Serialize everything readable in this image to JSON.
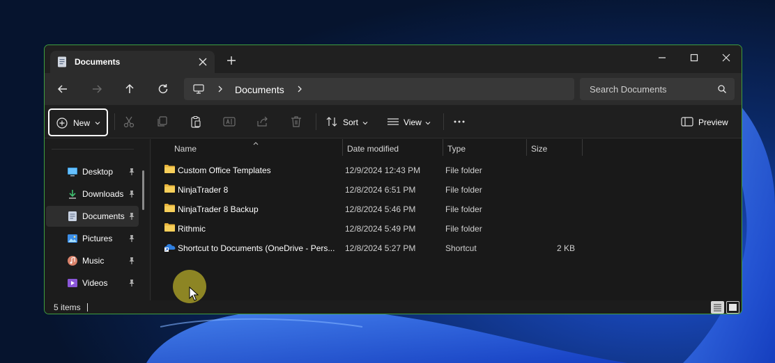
{
  "window": {
    "tab_title": "Documents",
    "accent_border": "#3f9f3f"
  },
  "navigation": {
    "breadcrumb": "Documents",
    "search_placeholder": "Search Documents"
  },
  "toolbar": {
    "new_label": "New",
    "sort_label": "Sort",
    "view_label": "View",
    "preview_label": "Preview"
  },
  "sidebar": {
    "items": [
      {
        "label": "Desktop",
        "icon": "desktop-icon",
        "pinned": true
      },
      {
        "label": "Downloads",
        "icon": "download-icon",
        "pinned": true
      },
      {
        "label": "Documents",
        "icon": "document-icon",
        "pinned": true,
        "selected": true
      },
      {
        "label": "Pictures",
        "icon": "pictures-icon",
        "pinned": true
      },
      {
        "label": "Music",
        "icon": "music-icon",
        "pinned": true
      },
      {
        "label": "Videos",
        "icon": "videos-icon",
        "pinned": true
      }
    ]
  },
  "filelist": {
    "columns": [
      "Name",
      "Date modified",
      "Type",
      "Size"
    ],
    "rows": [
      {
        "name": "Custom Office Templates",
        "date": "12/9/2024 12:43 PM",
        "type": "File folder",
        "size": "",
        "icon": "folder-icon"
      },
      {
        "name": "NinjaTrader 8",
        "date": "12/8/2024 6:51 PM",
        "type": "File folder",
        "size": "",
        "icon": "folder-icon"
      },
      {
        "name": "NinjaTrader 8 Backup",
        "date": "12/8/2024 5:46 PM",
        "type": "File folder",
        "size": "",
        "icon": "folder-icon"
      },
      {
        "name": "Rithmic",
        "date": "12/8/2024 5:49 PM",
        "type": "File folder",
        "size": "",
        "icon": "folder-icon"
      },
      {
        "name": "Shortcut to Documents (OneDrive - Pers...",
        "date": "12/8/2024 5:27 PM",
        "type": "Shortcut",
        "size": "2 KB",
        "icon": "onedrive-shortcut-icon"
      }
    ]
  },
  "status": {
    "item_count": "5 items"
  }
}
